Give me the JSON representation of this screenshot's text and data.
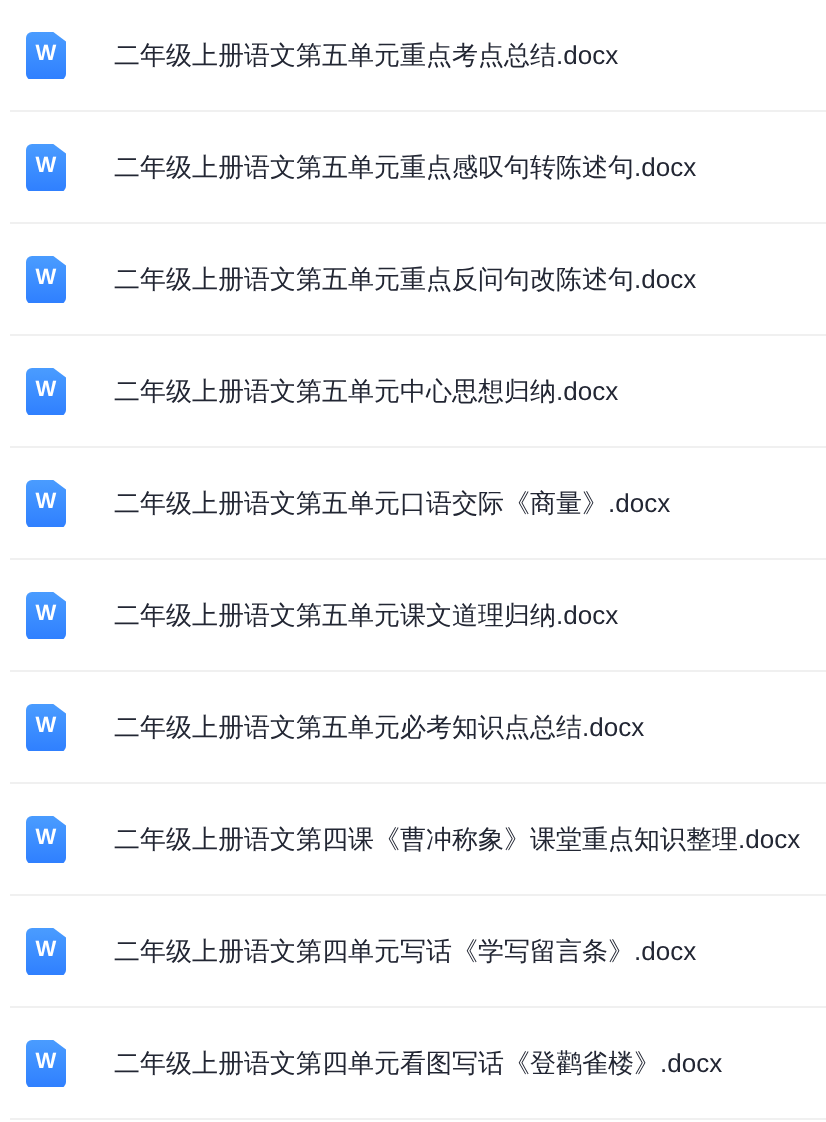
{
  "files": [
    {
      "name": "二年级上册语文第五单元重点考点总结.docx",
      "icon": "W"
    },
    {
      "name": "二年级上册语文第五单元重点感叹句转陈述句.docx",
      "icon": "W"
    },
    {
      "name": "二年级上册语文第五单元重点反问句改陈述句.docx",
      "icon": "W"
    },
    {
      "name": "二年级上册语文第五单元中心思想归纳.docx",
      "icon": "W"
    },
    {
      "name": "二年级上册语文第五单元口语交际《商量》.docx",
      "icon": "W"
    },
    {
      "name": "二年级上册语文第五单元课文道理归纳.docx",
      "icon": "W"
    },
    {
      "name": "二年级上册语文第五单元必考知识点总结.docx",
      "icon": "W"
    },
    {
      "name": "二年级上册语文第四课《曹冲称象》课堂重点知识整理.docx",
      "icon": "W"
    },
    {
      "name": "二年级上册语文第四单元写话《学写留言条》.docx",
      "icon": "W"
    },
    {
      "name": "二年级上册语文第四单元看图写话《登鹳雀楼》.docx",
      "icon": "W"
    }
  ]
}
